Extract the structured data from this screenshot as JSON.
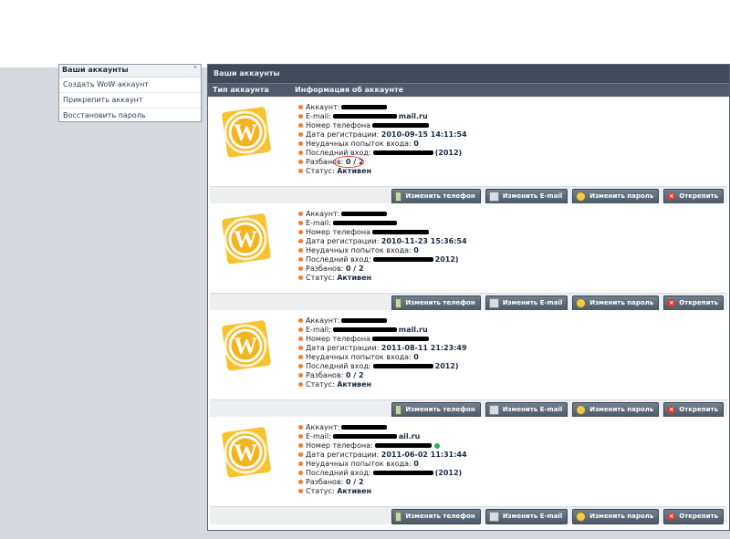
{
  "sidebar": {
    "title": "Ваши аккаунты",
    "items": [
      {
        "label": "Создать WoW аккаунт"
      },
      {
        "label": "Прикрепить аккаунт"
      },
      {
        "label": "Восстановить пароль"
      }
    ]
  },
  "panel": {
    "title": "Ваши аккаунты",
    "col_type": "Тип аккаунта",
    "col_info": "Информация об аккаунте"
  },
  "labels": {
    "account": "Аккаунт:",
    "email": "E-mail:",
    "phone": "Номер телефона",
    "phone_colon": "Номер телефона:",
    "reg_date": "Дата регистрации:",
    "failed": "Неудачных попыток входа:",
    "last_login": "Последний вход:",
    "bans": "Разбанов:",
    "status": "Статус:"
  },
  "accounts": [
    {
      "email_suffix": "mail.ru",
      "reg_date": "2010-09-15 14:11:54",
      "failed": "0",
      "last_login_year": "(2012)",
      "bans": "0 / 2",
      "status": "Активен"
    },
    {
      "email_suffix": "",
      "reg_date": "2010-11-23 15:36:54",
      "failed": "0",
      "last_login_year": "2012)",
      "bans": "0 / 2",
      "status": "Активен"
    },
    {
      "email_suffix": "mail.ru",
      "reg_date": "2011-08-11 21:23:49",
      "failed": "0",
      "last_login_year": "2012)",
      "bans": "0 / 2",
      "status": "Активен"
    },
    {
      "email_suffix": "ail.ru",
      "reg_date": "2011-06-02 11:31:44",
      "failed": "0",
      "last_login_year": "(2012)",
      "bans": "0 / 2",
      "status": "Активен"
    }
  ],
  "buttons": {
    "change_phone": "Изменить телефон",
    "change_email": "Изменить E-mail",
    "change_password": "Изменить пароль",
    "unlink": "Открепить"
  },
  "colors": {
    "accent": "#ef7f2a",
    "header": "#3d4b5a",
    "logo": "#f2b41f"
  }
}
